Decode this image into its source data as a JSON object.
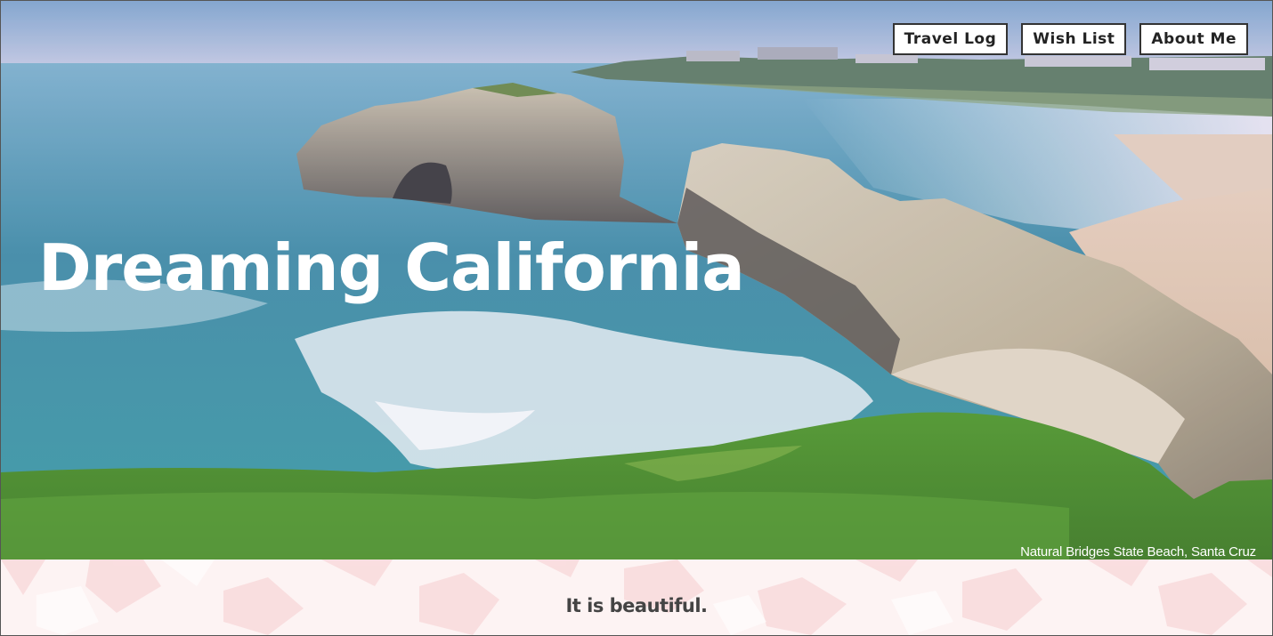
{
  "nav": {
    "items": [
      {
        "label": "Travel Log"
      },
      {
        "label": "Wish List"
      },
      {
        "label": "About Me"
      }
    ]
  },
  "hero": {
    "title": "Dreaming California",
    "caption": "Natural Bridges State Beach, Santa Cruz"
  },
  "section": {
    "tagline": "It is beautiful."
  },
  "colors": {
    "nav_border": "#333333",
    "title_text": "#ffffff",
    "pattern_pink": "#f8d7d9",
    "tagline_text": "#444444"
  }
}
